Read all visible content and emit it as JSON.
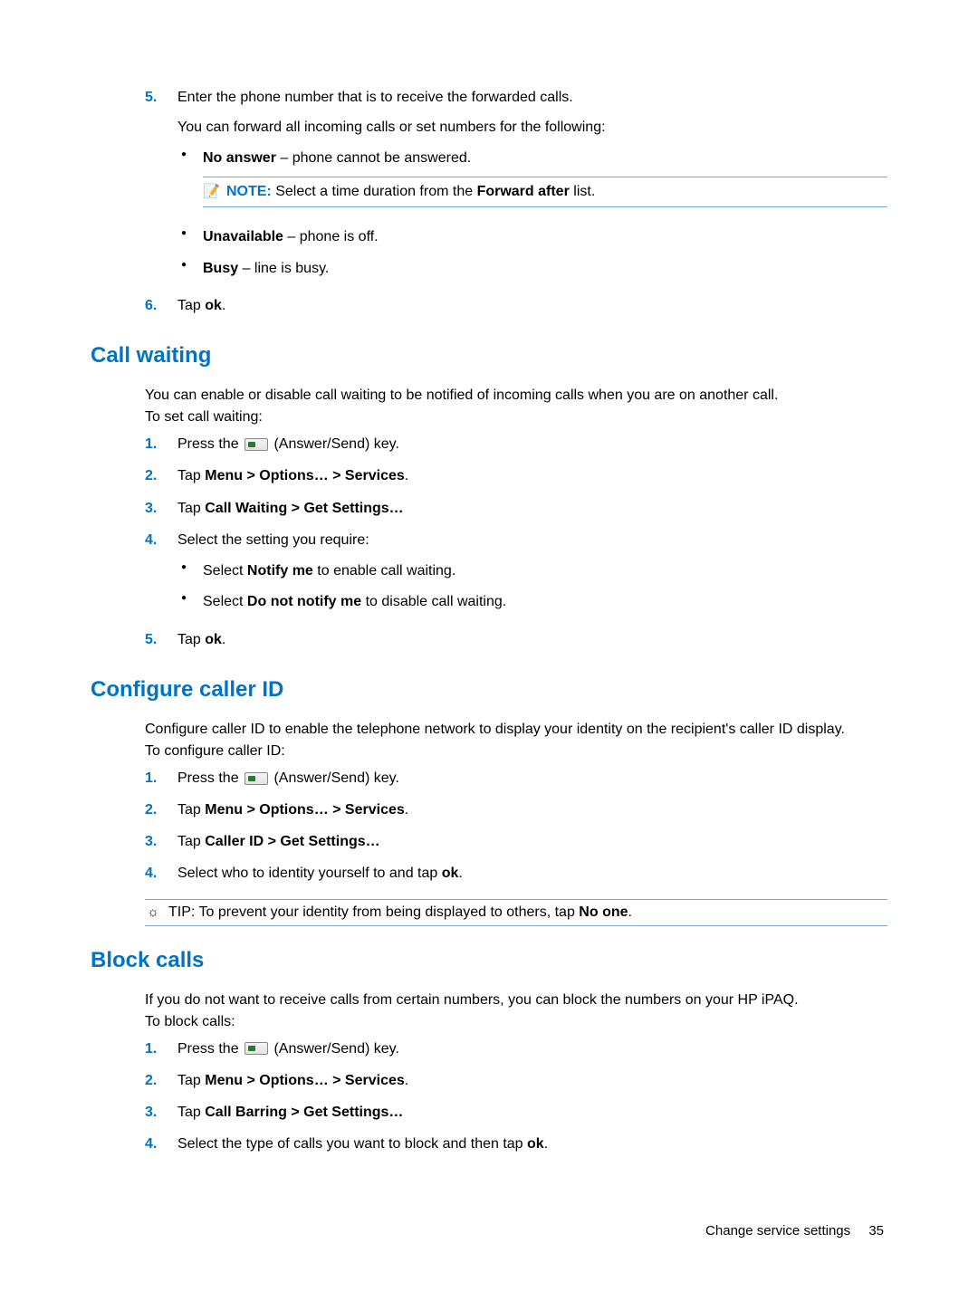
{
  "forwarding": {
    "step5_num": "5.",
    "step5_text": "Enter the phone number that is to receive the forwarded calls.",
    "step5_sub": "You can forward all incoming calls or set numbers for the following:",
    "opt_noanswer_b": "No answer",
    "opt_noanswer_t": " – phone cannot be answered.",
    "note_label": "NOTE:",
    "note_text_a": "Select a time duration from the ",
    "note_bold": "Forward after",
    "note_text_b": " list.",
    "opt_unavail_b": "Unavailable",
    "opt_unavail_t": " – phone is off.",
    "opt_busy_b": "Busy",
    "opt_busy_t": " – line is busy.",
    "step6_num": "6.",
    "step6_a": "Tap ",
    "step6_b": "ok",
    "step6_c": "."
  },
  "callwaiting": {
    "heading": "Call waiting",
    "intro1": "You can enable or disable call waiting to be notified of incoming calls when you are on another call.",
    "intro2": "To set call waiting:",
    "s1_num": "1.",
    "s1_a": "Press the ",
    "s1_b": " (Answer/Send) key.",
    "s2_num": "2.",
    "s2_a": "Tap ",
    "s2_b": "Menu > Options… > Services",
    "s2_c": ".",
    "s3_num": "3.",
    "s3_a": "Tap ",
    "s3_b": "Call Waiting > Get Settings…",
    "s4_num": "4.",
    "s4_a": "Select the setting you require:",
    "b1_a": "Select ",
    "b1_b": "Notify me",
    "b1_c": " to enable call waiting.",
    "b2_a": "Select ",
    "b2_b": "Do not notify me",
    "b2_c": " to disable call waiting.",
    "s5_num": "5.",
    "s5_a": "Tap ",
    "s5_b": "ok",
    "s5_c": "."
  },
  "callerid": {
    "heading": "Configure caller ID",
    "intro1": "Configure caller ID to enable the telephone network to display your identity on the recipient's caller ID display.",
    "intro2": "To configure caller ID:",
    "s1_num": "1.",
    "s1_a": "Press the ",
    "s1_b": " (Answer/Send) key.",
    "s2_num": "2.",
    "s2_a": "Tap ",
    "s2_b": "Menu > Options… > Services",
    "s2_c": ".",
    "s3_num": "3.",
    "s3_a": "Tap ",
    "s3_b": "Caller ID > Get Settings…",
    "s4_num": "4.",
    "s4_a": "Select who to identity yourself to and tap ",
    "s4_b": "ok",
    "s4_c": ".",
    "tip_label": "TIP:",
    "tip_a": "To prevent your identity from being displayed to others, tap ",
    "tip_b": "No one",
    "tip_c": "."
  },
  "blockcalls": {
    "heading": "Block calls",
    "intro1": "If you do not want to receive calls from certain numbers, you can block the numbers on your HP iPAQ.",
    "intro2": "To block calls:",
    "s1_num": "1.",
    "s1_a": "Press the ",
    "s1_b": " (Answer/Send) key.",
    "s2_num": "2.",
    "s2_a": "Tap ",
    "s2_b": "Menu > Options… > Services",
    "s2_c": ".",
    "s3_num": "3.",
    "s3_a": "Tap ",
    "s3_b": "Call Barring > Get Settings…",
    "s4_num": "4.",
    "s4_a": "Select the type of calls you want to block and then tap ",
    "s4_b": "ok",
    "s4_c": "."
  },
  "footer": {
    "section": "Change service settings",
    "page": "35"
  }
}
